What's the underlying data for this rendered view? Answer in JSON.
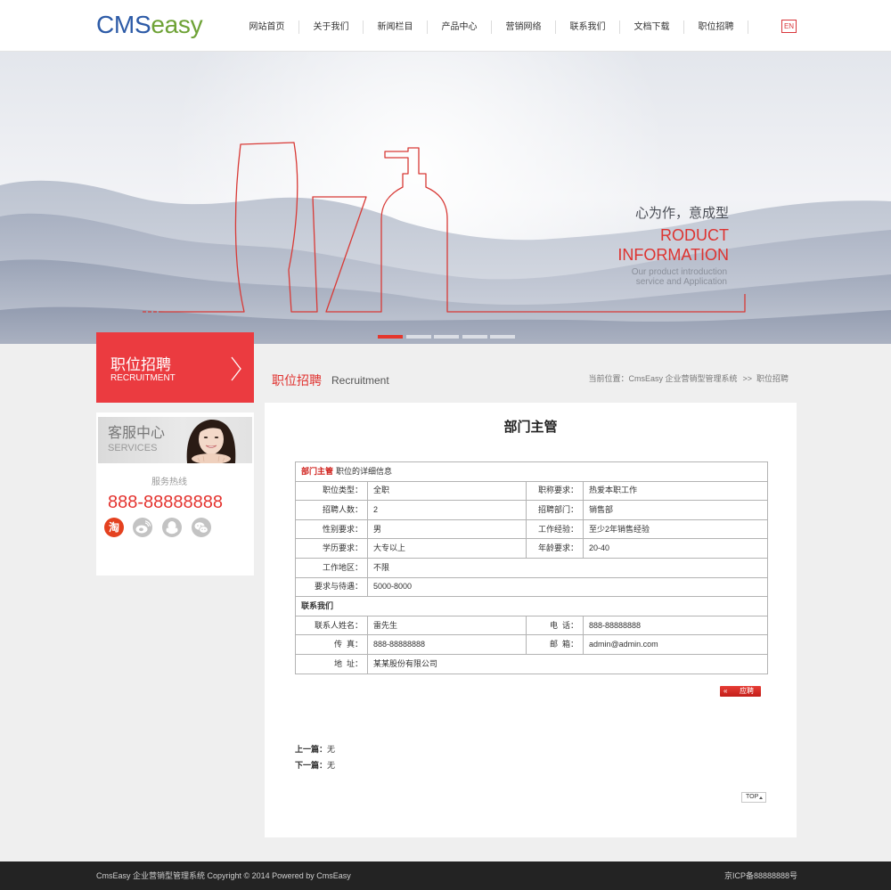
{
  "header": {
    "logo": {
      "cms": "CMS",
      "easy": "easy"
    },
    "nav": [
      {
        "label": "网站首页"
      },
      {
        "label": "关于我们"
      },
      {
        "label": "新闻栏目"
      },
      {
        "label": "产品中心"
      },
      {
        "label": "营销网络"
      },
      {
        "label": "联系我们"
      },
      {
        "label": "文档下载"
      },
      {
        "label": "职位招聘"
      }
    ],
    "language": "EN"
  },
  "banner": {
    "slogan": "心为作，意成型",
    "title_line1": "RODUCT",
    "title_line2": "INFORMATION",
    "subtitle_line1": "Our product introduction",
    "subtitle_line2": "service and Application",
    "slider": {
      "count": 5,
      "active": 1
    }
  },
  "sidebar": {
    "section_title": "职位招聘",
    "section_title_en": "RECRUITMENT",
    "section_icon": "chevron-right-icon",
    "service": {
      "title": "客服中心",
      "title_en": "SERVICES",
      "hotline_label": "服务热线",
      "hotline": "888-88888888",
      "social": [
        {
          "icon": "taobao-icon",
          "glyph": "淘"
        },
        {
          "icon": "weibo-icon"
        },
        {
          "icon": "qq-icon"
        },
        {
          "icon": "wechat-icon"
        }
      ]
    }
  },
  "main": {
    "title": "职位招聘",
    "title_en": "Recruitment",
    "breadcrumb": {
      "label": "当前位置：",
      "home": "CmsEasy 企业营销型管理系统",
      "separator": ">>",
      "current": "职位招聘"
    }
  },
  "job": {
    "title": "部门主管",
    "caption": {
      "name": "部门主管",
      "text": "职位的详细信息"
    },
    "details": [
      [
        {
          "label": "职位类型：",
          "value": "全职"
        },
        {
          "label": "职称要求：",
          "value": "热爱本职工作"
        }
      ],
      [
        {
          "label": "招聘人数：",
          "value": "2"
        },
        {
          "label": "招聘部门：",
          "value": "销售部"
        }
      ],
      [
        {
          "label": "性别要求：",
          "value": "男"
        },
        {
          "label": "工作经验：",
          "value": "至少2年销售经验"
        }
      ],
      [
        {
          "label": "学历要求：",
          "value": "大专以上"
        },
        {
          "label": "年龄要求：",
          "value": "20-40"
        }
      ],
      [
        {
          "label": "工作地区：",
          "value": "不限"
        }
      ],
      [
        {
          "label": "要求与待遇：",
          "value": "5000-8000"
        }
      ]
    ],
    "contact_heading": "联系我们",
    "contact": [
      [
        {
          "label": "联系人姓名：",
          "value": "雷先生"
        },
        {
          "label": "电  话：",
          "value": "888-88888888"
        }
      ],
      [
        {
          "label": "传  真：",
          "value": "888-88888888"
        },
        {
          "label": "邮  箱：",
          "value": "admin@admin.com"
        }
      ],
      [
        {
          "label": "地  址：",
          "value": "某某股份有限公司"
        }
      ]
    ],
    "apply": {
      "arrow": "«",
      "label": "应聘"
    }
  },
  "pager": {
    "prev_label": "上一篇：",
    "prev": "无",
    "next_label": "下一篇：",
    "next": "无"
  },
  "back_to_top": "TOP",
  "footer": {
    "copyright": "CmsEasy 企业营销型管理系统 Copyright © 2014 Powered by CmsEasy",
    "icp": "京ICP备88888888号"
  },
  "theme": {
    "accent": "#eb3b40",
    "logo_blue": "#2d5ba7",
    "logo_green": "#6ea236",
    "footer_bg": "#232323"
  }
}
